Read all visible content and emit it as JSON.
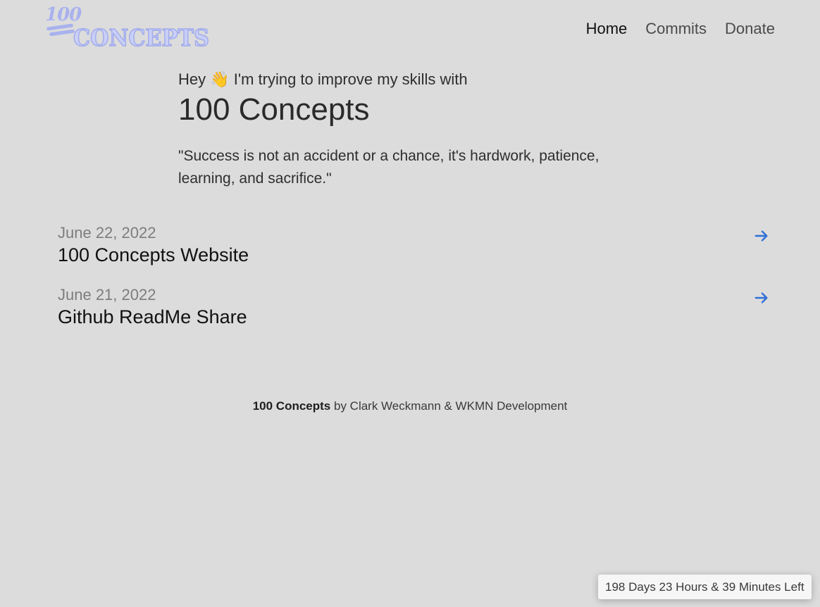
{
  "header": {
    "logo_text_top": "100",
    "logo_text_bottom": "CONCEPTS",
    "nav": [
      {
        "label": "Home",
        "active": true
      },
      {
        "label": "Commits",
        "active": false
      },
      {
        "label": "Donate",
        "active": false
      }
    ]
  },
  "hero": {
    "greeting_before": "Hey ",
    "greeting_emoji": "👋",
    "greeting_after": " I'm trying to improve my skills with",
    "title": "100 Concepts",
    "quote": "\"Success is not an accident or a chance, it's hardwork, patience, learning, and sacrifice.\""
  },
  "posts": [
    {
      "date": "June 22, 2022",
      "title": "100 Concepts Website",
      "icon": "arrow-right-icon"
    },
    {
      "date": "June 21, 2022",
      "title": "Github ReadMe Share",
      "icon": "arrow-right-icon"
    }
  ],
  "footer": {
    "brand": "100 Concepts",
    "credit": " by Clark Weckmann & WKMN Development"
  },
  "countdown": {
    "text": "198 Days 23 Hours & 39 Minutes Left"
  },
  "colors": {
    "background": "#f6f6f6",
    "dot": "#dcdcdc",
    "logo": "#a9b2ee",
    "arrow": "#2f6fd6"
  }
}
